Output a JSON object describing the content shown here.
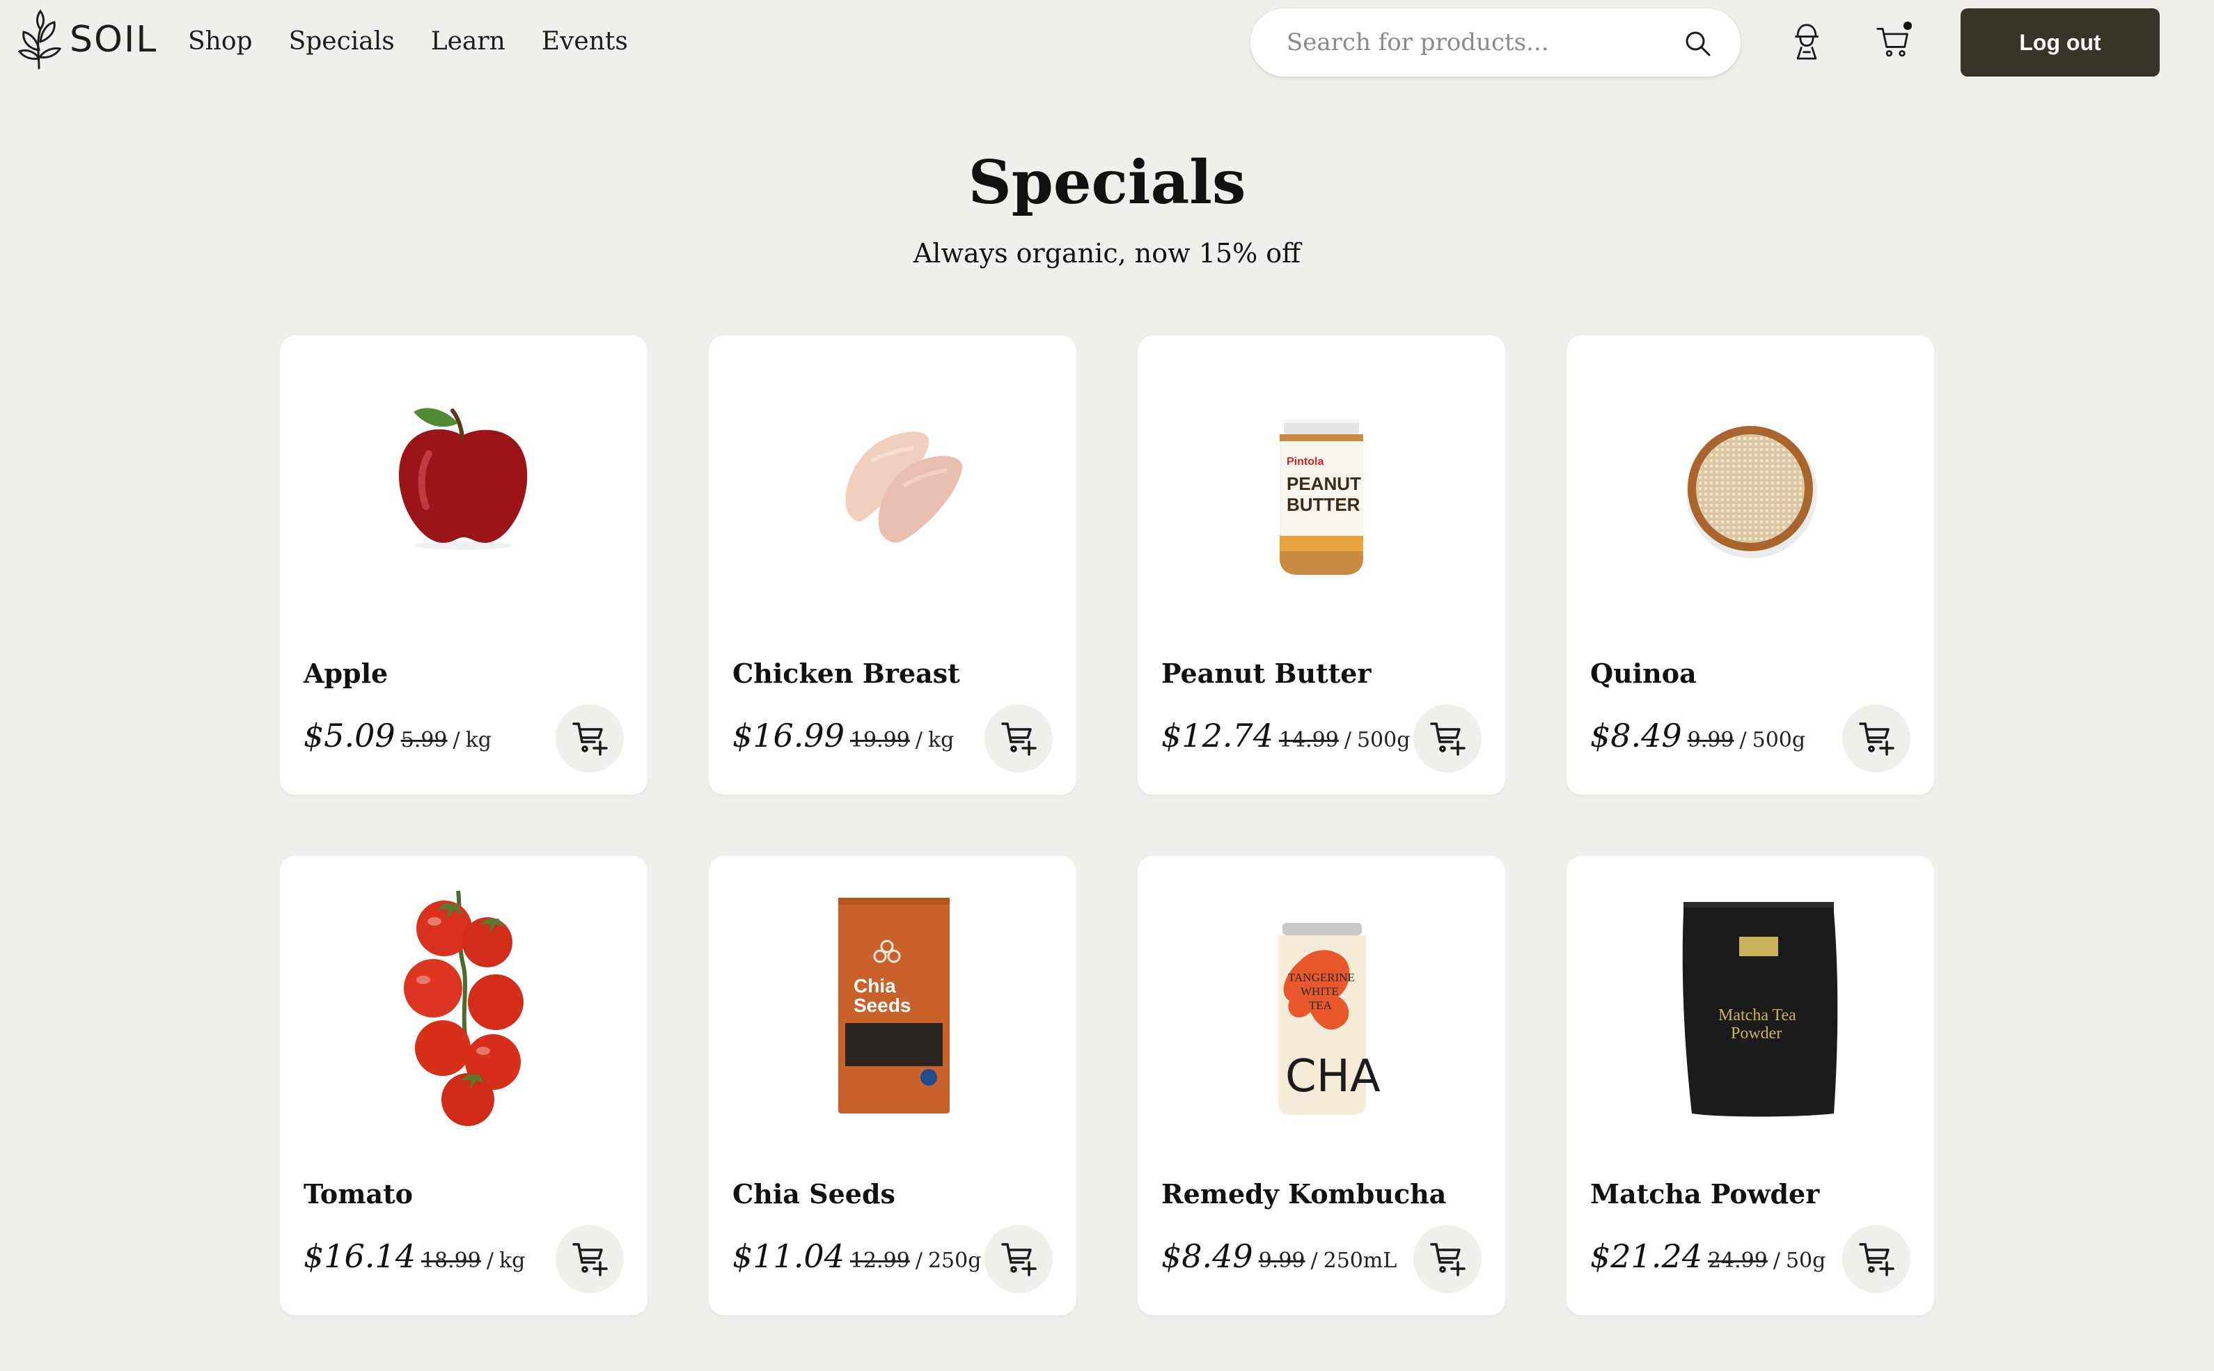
{
  "brand": {
    "name": "SOIL"
  },
  "nav": {
    "items": [
      {
        "label": "Shop"
      },
      {
        "label": "Specials"
      },
      {
        "label": "Learn"
      },
      {
        "label": "Events"
      }
    ]
  },
  "search": {
    "placeholder": "Search for products...",
    "value": "",
    "icon": "search-icon"
  },
  "header_icons": {
    "profile": "user-icon",
    "cart": "cart-icon",
    "cart_has_items": true
  },
  "auth": {
    "logout_label": "Log out"
  },
  "page": {
    "title": "Specials",
    "subtitle": "Always organic, now 15% off"
  },
  "products": [
    {
      "name": "Apple",
      "price": "$5.09",
      "old_price": "5.99",
      "sep": "/",
      "unit": "kg",
      "image": "apple"
    },
    {
      "name": "Chicken Breast",
      "price": "$16.99",
      "old_price": "19.99",
      "sep": "/",
      "unit": "kg",
      "image": "chicken"
    },
    {
      "name": "Peanut Butter",
      "price": "$12.74",
      "old_price": "14.99",
      "sep": "/",
      "unit": "500g",
      "image": "peanut-butter",
      "label_brand": "Pintola",
      "label_line1": "PEANUT",
      "label_line2": "BUTTER"
    },
    {
      "name": "Quinoa",
      "price": "$8.49",
      "old_price": "9.99",
      "sep": "/",
      "unit": "500g",
      "image": "quinoa"
    },
    {
      "name": "Tomato",
      "price": "$16.14",
      "old_price": "18.99",
      "sep": "/",
      "unit": "kg",
      "image": "tomato"
    },
    {
      "name": "Chia Seeds",
      "price": "$11.04",
      "old_price": "12.99",
      "sep": "/",
      "unit": "250g",
      "image": "chia-seeds",
      "label_line1": "Chia",
      "label_line2": "Seeds"
    },
    {
      "name": "Remedy Kombucha",
      "price": "$8.49",
      "old_price": "9.99",
      "sep": "/",
      "unit": "250mL",
      "image": "kombucha",
      "label_line1": "TANGERINE",
      "label_line2": "WHITE",
      "label_line3": "TEA",
      "label_big": "CHA"
    },
    {
      "name": "Matcha Powder",
      "price": "$21.24",
      "old_price": "24.99",
      "sep": "/",
      "unit": "50g",
      "image": "matcha",
      "label_line1": "Matcha Tea",
      "label_line2": "Powder"
    }
  ],
  "add_button_icon": "add-to-cart-icon"
}
